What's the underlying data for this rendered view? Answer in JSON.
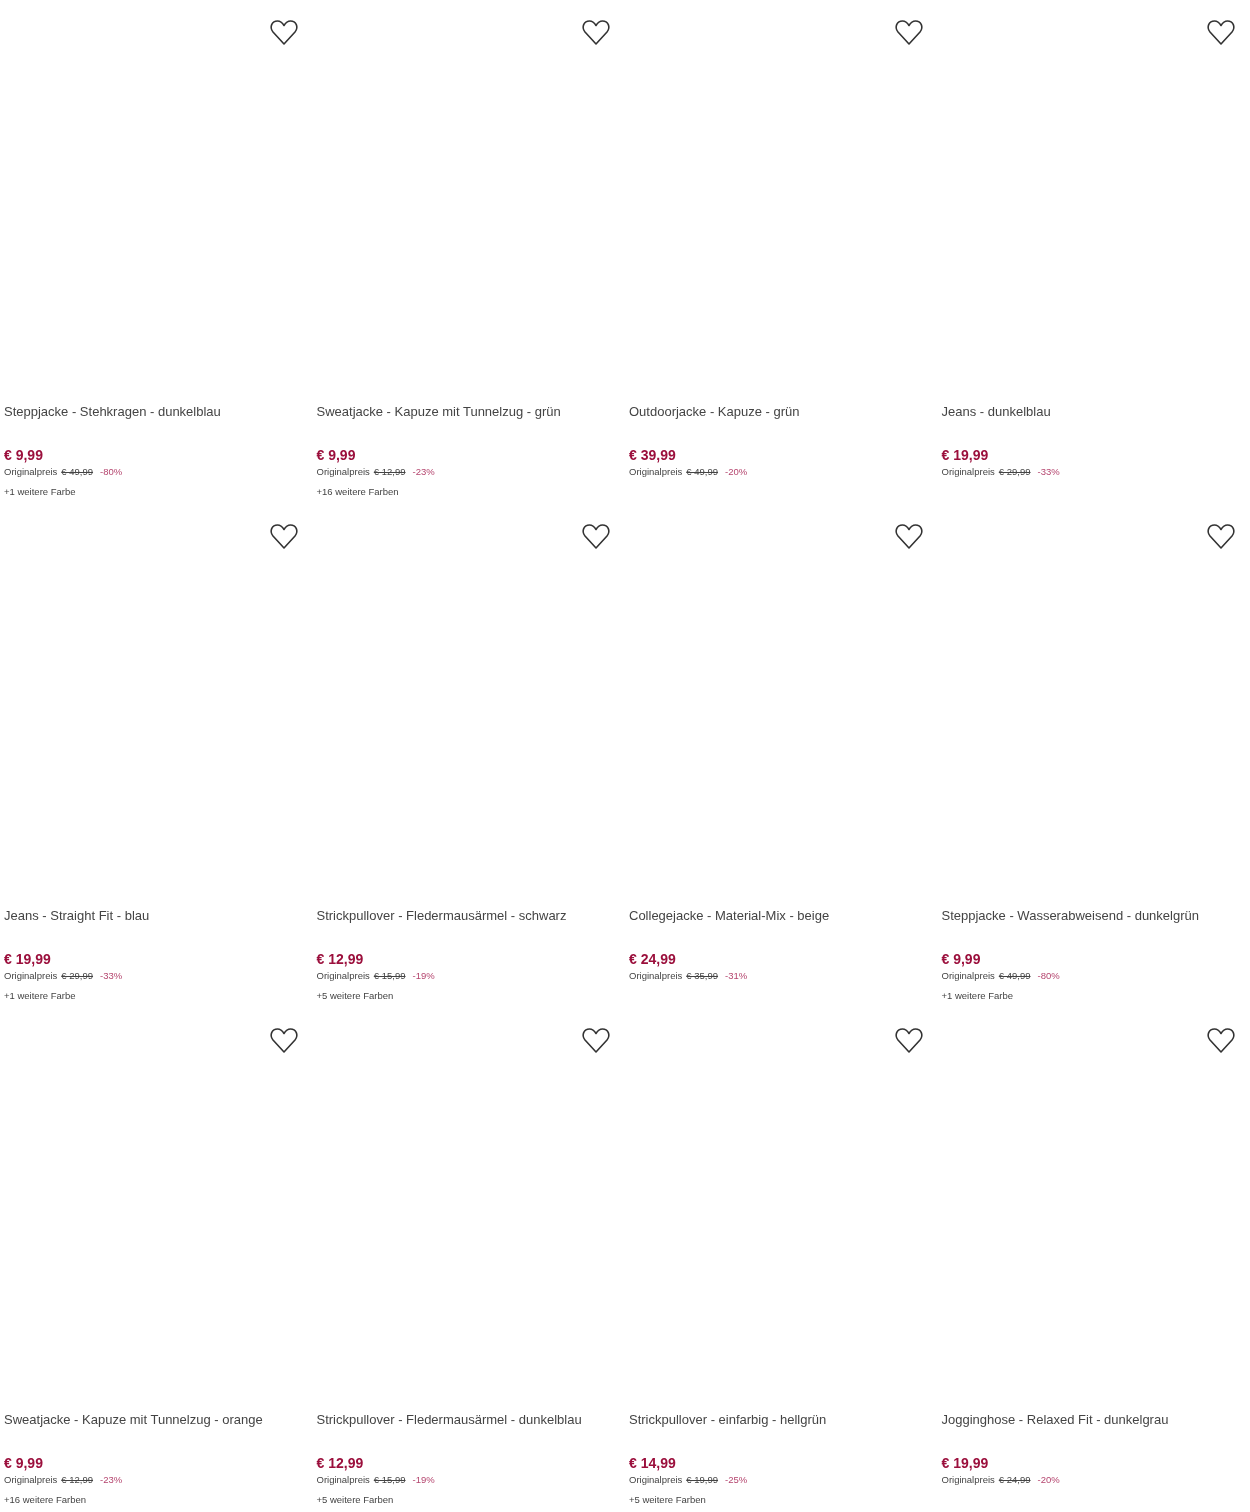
{
  "products": [
    {
      "title": "Steppjacke - Stehkragen - dunkelblau",
      "price": "€ 9,99",
      "original_label": "Originalpreis",
      "original_price": "€ 49,99",
      "discount": "-80%",
      "more_colors": "+1 weitere Farbe"
    },
    {
      "title": "Sweatjacke - Kapuze mit Tunnelzug - grün",
      "price": "€ 9,99",
      "original_label": "Originalpreis",
      "original_price": "€ 12,99",
      "discount": "-23%",
      "more_colors": "+16 weitere Farben"
    },
    {
      "title": "Outdoorjacke - Kapuze - grün",
      "price": "€ 39,99",
      "original_label": "Originalpreis",
      "original_price": "€ 49,99",
      "discount": "-20%"
    },
    {
      "title": "Jeans - dunkelblau",
      "price": "€ 19,99",
      "original_label": "Originalpreis",
      "original_price": "€ 29,99",
      "discount": "-33%"
    },
    {
      "title": "Jeans - Straight Fit - blau",
      "price": "€ 19,99",
      "original_label": "Originalpreis",
      "original_price": "€ 29,99",
      "discount": "-33%",
      "more_colors": "+1 weitere Farbe"
    },
    {
      "title": "Strickpullover - Fledermausärmel - schwarz",
      "price": "€ 12,99",
      "original_label": "Originalpreis",
      "original_price": "€ 15,99",
      "discount": "-19%",
      "more_colors": "+5 weitere Farben"
    },
    {
      "title": "Collegejacke - Material-Mix - beige",
      "price": "€ 24,99",
      "original_label": "Originalpreis",
      "original_price": "€ 35,99",
      "discount": "-31%"
    },
    {
      "title": "Steppjacke - Wasserabweisend - dunkelgrün",
      "price": "€ 9,99",
      "original_label": "Originalpreis",
      "original_price": "€ 49,99",
      "discount": "-80%",
      "more_colors": "+1 weitere Farbe"
    },
    {
      "title": "Sweatjacke - Kapuze mit Tunnelzug - orange",
      "price": "€ 9,99",
      "original_label": "Originalpreis",
      "original_price": "€ 12,99",
      "discount": "-23%",
      "more_colors": "+16 weitere Farben"
    },
    {
      "title": "Strickpullover - Fledermausärmel - dunkelblau",
      "price": "€ 12,99",
      "original_label": "Originalpreis",
      "original_price": "€ 15,99",
      "discount": "-19%",
      "more_colors": "+5 weitere Farben"
    },
    {
      "title": "Strickpullover - einfarbig - hellgrün",
      "price": "€ 14,99",
      "original_label": "Originalpreis",
      "original_price": "€ 19,99",
      "discount": "-25%",
      "more_colors": "+5 weitere Farben"
    },
    {
      "title": "Jogginghose - Relaxed Fit - dunkelgrau",
      "price": "€ 19,99",
      "original_label": "Originalpreis",
      "original_price": "€ 24,99",
      "discount": "-20%"
    }
  ]
}
